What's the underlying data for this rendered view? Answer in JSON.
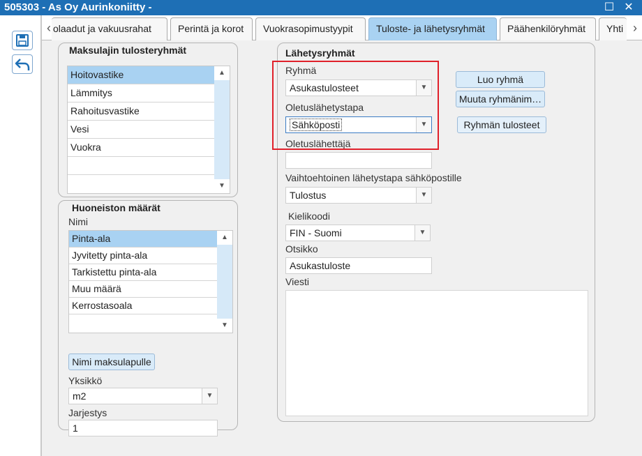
{
  "window": {
    "title": "505303 - As Oy Aurinkoniitty -"
  },
  "tabs": [
    {
      "label": "olaadut ja vakuusrahat"
    },
    {
      "label": "Perintä ja korot"
    },
    {
      "label": "Vuokrasopimustyypit"
    },
    {
      "label": "Tuloste- ja lähetysryhmät",
      "active": true
    },
    {
      "label": "Päähenkilöryhmät"
    },
    {
      "label": "Yhti"
    }
  ],
  "maksulajit": {
    "title": "Maksulajin tulosteryhmät",
    "items": [
      "Hoitovastike",
      "Lämmitys",
      "Rahoitusvastike",
      "Vesi",
      "Vuokra",
      "",
      ""
    ],
    "selected": 0
  },
  "huoneisto": {
    "title": "Huoneiston määrät",
    "nimi_label": "Nimi",
    "items": [
      "Pinta-ala",
      "Jyvitetty pinta-ala",
      "Tarkistettu pinta-ala",
      "Muu määrä",
      "Kerrostasoala",
      ""
    ],
    "selected": 0,
    "nimi_button": "Nimi maksulapulle",
    "yksikko_label": "Yksikkö",
    "yksikko_value": "m2",
    "jarjestys_label": "Jarjestys",
    "jarjestys_value": "1"
  },
  "lahetys": {
    "title": "Lähetysryhmät",
    "ryhma_label": "Ryhmä",
    "ryhma_value": "Asukastulosteet",
    "oletustapa_label": "Oletuslähetystapa",
    "oletustapa_value": "Sähköposti",
    "oletuslahettaja_label": "Oletuslähettäjä",
    "oletuslahettaja_value": "",
    "vaihtoehtoinen_label": "Vaihtoehtoinen lähetystapa sähköpostille",
    "vaihtoehtoinen_value": "Tulostus",
    "kielikoodi_label": "Kielikoodi",
    "kielikoodi_value": "FIN - Suomi",
    "otsikko_label": "Otsikko",
    "otsikko_value": "Asukastuloste",
    "viesti_label": "Viesti",
    "viesti_value": "",
    "buttons": {
      "luo": "Luo ryhmä",
      "muuta": "Muuta ryhmänim…",
      "tulosteet": "Ryhmän tulosteet"
    }
  },
  "colors": {
    "titlebar": "#1e6fb5",
    "active_tab": "#a9d2f2",
    "selection": "#a9d2f2",
    "highlight_box": "#e0202a"
  }
}
